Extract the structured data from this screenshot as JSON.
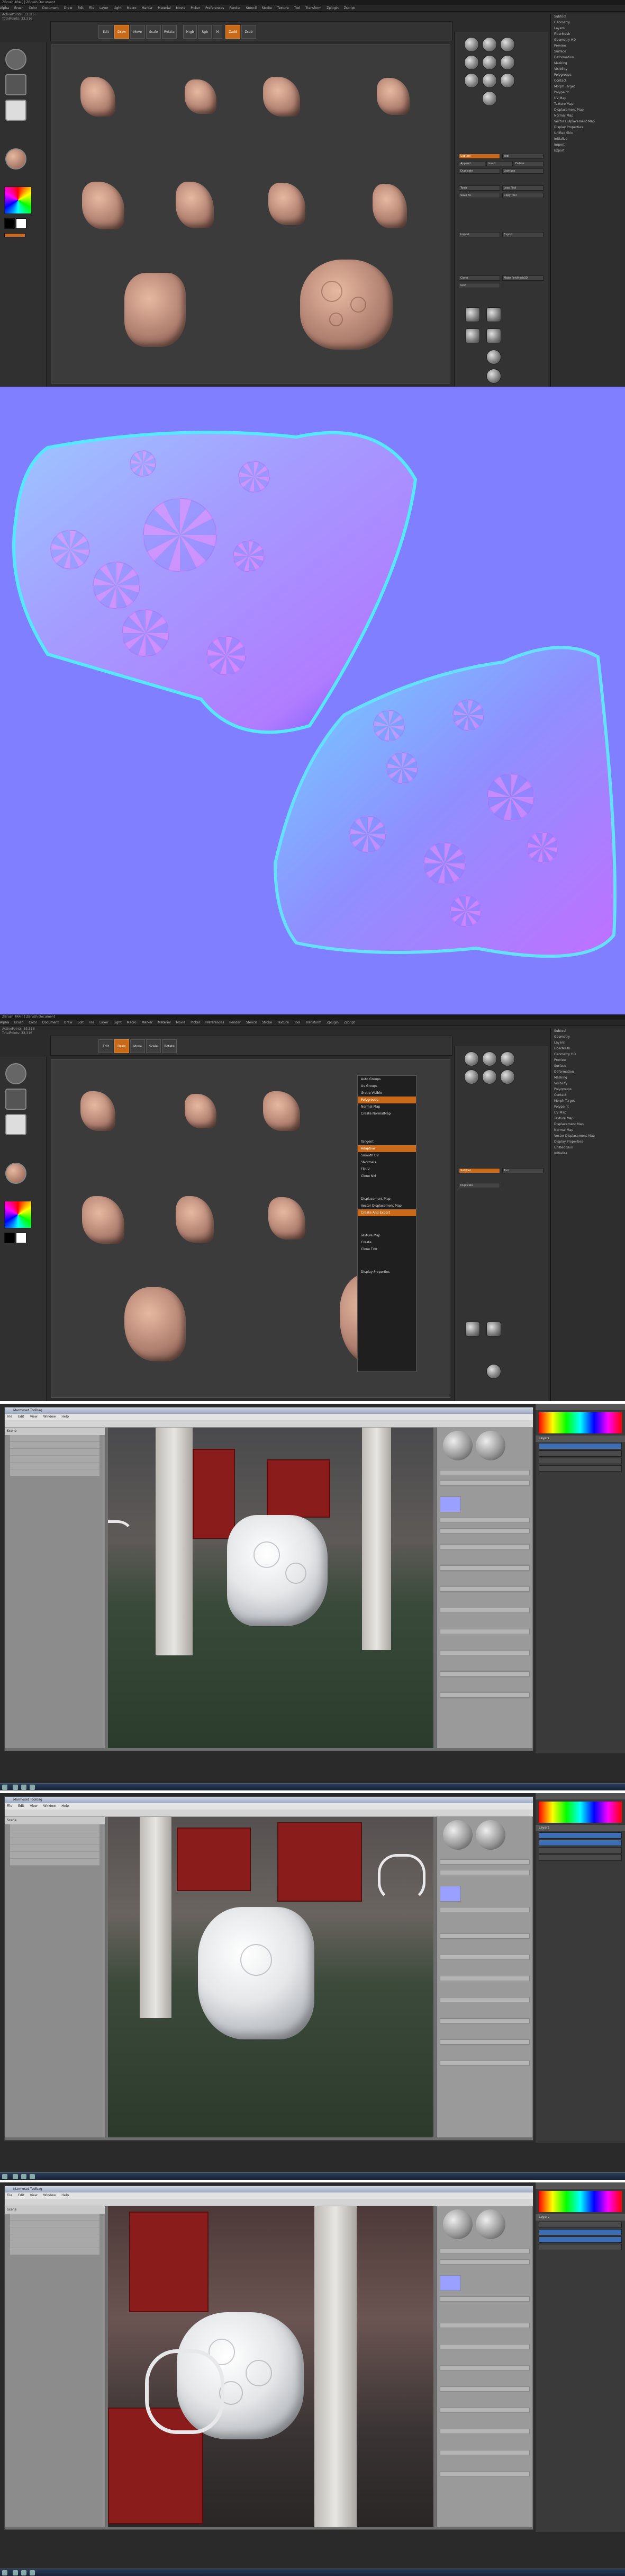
{
  "zbrush": {
    "title_bar": "ZBrush 4R4 [ ] ZBrush Document",
    "menu_items": [
      "Alpha",
      "Brush",
      "Color",
      "Document",
      "Draw",
      "Edit",
      "File",
      "Layer",
      "Light",
      "Macro",
      "Marker",
      "Material",
      "Movie",
      "Picker",
      "Preferences",
      "Render",
      "Stencil",
      "Stroke",
      "Texture",
      "Tool",
      "Transform",
      "Zplugin",
      "Zscript"
    ],
    "info_line_1": "ActivePoints: 33,316",
    "info_line_2": "TotalPoints: 33,316",
    "toolbar": {
      "edit": "Edit",
      "draw": "Draw",
      "move": "Move",
      "scale": "Scale",
      "rotate": "Rotate",
      "mrgb": "Mrgb",
      "rgb": "Rgb",
      "m": "M",
      "zadd": "Zadd",
      "zsub": "Zsub"
    },
    "tray_items": [
      "Subtool",
      "Geometry",
      "Layers",
      "FiberMesh",
      "Geometry HD",
      "Preview",
      "Surface",
      "Deformation",
      "Masking",
      "Visibility",
      "Polygroups",
      "Contact",
      "Morph Target",
      "Polypaint",
      "UV Map",
      "Texture Map",
      "Displacement Map",
      "Normal Map",
      "Vector Displacement Map",
      "Display Properties",
      "Unified Skin",
      "Initialize",
      "Import",
      "Export"
    ],
    "right_panel_buttons": [
      "SubTool",
      "Tool",
      "Append",
      "Insert",
      "Delete",
      "Duplicate",
      "Lightbox",
      "Tools",
      "Load Tool",
      "Save As",
      "Copy Tool",
      "Import",
      "Export",
      "Clone",
      "Make PolyMesh3D",
      "GoZ"
    ],
    "dropdown_items": [
      "Auto Groups",
      "Uv Groups",
      "Group Visible",
      "Polygroups",
      "Normal Map",
      "Create NormalMap",
      "Tangent",
      "Adaptive",
      "Smooth UV",
      "SNormals",
      "Flip V",
      "Clone NM",
      "Displacement Map",
      "Vector Displacement Map",
      "Create And Export",
      "Texture Map",
      "Create",
      "Clone Txtr",
      "Display Properties"
    ],
    "bottom_status": ""
  },
  "photoshop": {
    "title_bar": "Marmoset Toolbag",
    "menu_items": [
      "File",
      "Edit",
      "View",
      "Window",
      "Help"
    ],
    "panel_header": "Scene",
    "side_header": "Material",
    "layers_header": "Layers"
  },
  "colors": {
    "accent_orange": "#c96a1a",
    "normal_map_base": "#7f7fff",
    "zbrush_bg": "#2b2b2b"
  }
}
